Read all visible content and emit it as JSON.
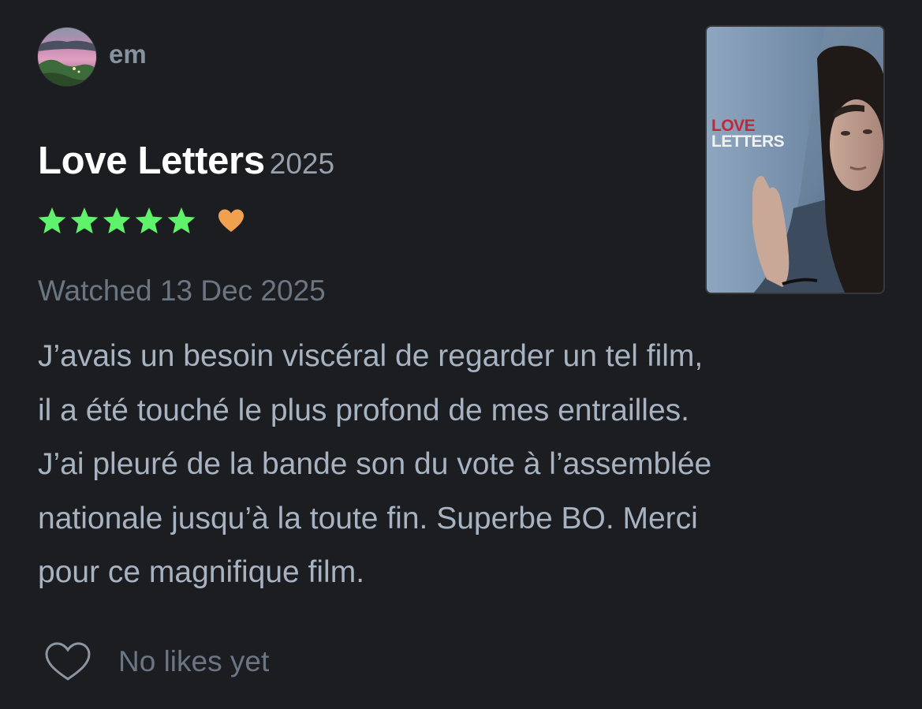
{
  "user": {
    "name": "em",
    "avatar_icon": "profile-photo"
  },
  "film": {
    "title": "Love Letters",
    "year": "2025",
    "poster": {
      "logo_line1": "LOVE",
      "logo_line2": "LETTERS"
    }
  },
  "rating": {
    "stars": 5,
    "max_stars": 5,
    "liked": true,
    "star_color": "#5ff26b",
    "heart_color": "#f0a150"
  },
  "watched": "Watched 13 Dec 2025",
  "review": {
    "text": "J’avais un besoin viscéral de regarder un tel film,\nil a été touché le plus profond de mes entrailles.\nJ’ai pleuré de la bande son du vote à l’assemblée\nnationale jusqu’à la toute fin. Superbe BO. Merci\npour ce magnifique film."
  },
  "likes": {
    "icon": "heart-outline-icon",
    "text": "No likes yet"
  }
}
